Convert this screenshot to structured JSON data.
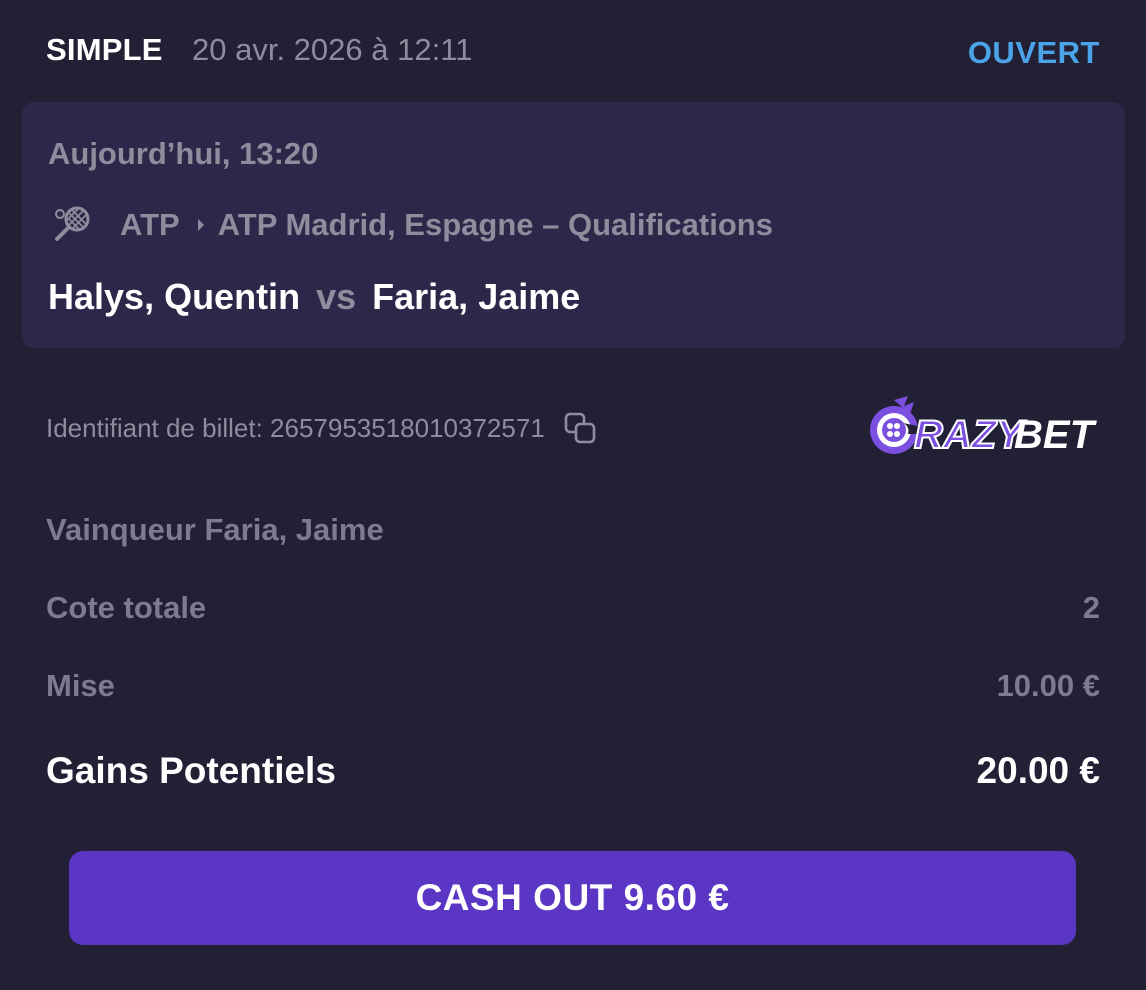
{
  "header": {
    "bet_type": "SIMPLE",
    "date": "20 avr. 2026 à 12:11",
    "status": "OUVERT"
  },
  "event": {
    "time": "Aujourd’hui, 13:20",
    "sport_icon": "tennis-racket-icon",
    "category": "ATP",
    "tournament": "ATP Madrid, Espagne – Qualifications",
    "home": "Halys, Quentin",
    "vs": "vs",
    "away": "Faria, Jaime"
  },
  "ticket": {
    "label": "Identifiant de billet: 2657953518010372571",
    "copy_icon": "copy-icon"
  },
  "brand": {
    "logo_text": "CRAZYBET",
    "accent": "#5b36c4"
  },
  "details": {
    "selection": "Vainqueur Faria, Jaime",
    "odds_label": "Cote totale",
    "odds_value": "2",
    "stake_label": "Mise",
    "stake_value": "10.00 €",
    "payout_label": "Gains Potentiels",
    "payout_value": "20.00 €"
  },
  "cashout": {
    "label": "CASH OUT 9.60 €"
  },
  "colors": {
    "background": "#222035",
    "event_box": "#2d2849",
    "status": "#4ba3e8",
    "button": "#5b36c4"
  }
}
